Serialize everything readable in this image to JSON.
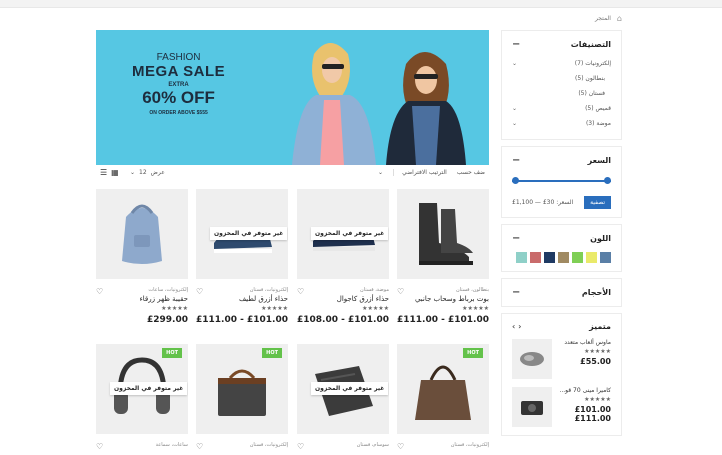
{
  "breadcrumb": {
    "current": "المتجر"
  },
  "sidebar": {
    "categories": {
      "title": "التصنيفات",
      "items": [
        {
          "label": "إلكترونيات (7)",
          "has_children": true,
          "sub": false
        },
        {
          "label": "بنطالون (5)",
          "has_children": false,
          "sub": true
        },
        {
          "label": "فستان (5)",
          "has_children": false,
          "sub": true
        },
        {
          "label": "قميص (5)",
          "has_children": true,
          "sub": false
        },
        {
          "label": "موضة (3)",
          "has_children": true,
          "sub": false
        }
      ]
    },
    "price": {
      "title": "السعر",
      "range_label": "السعر: 30£ — 1,100£",
      "filter_label": "تصفية"
    },
    "color": {
      "title": "اللون",
      "swatches": [
        "#5a7fa6",
        "#eaea6a",
        "#7fcf55",
        "#a08a62",
        "#1f3a63",
        "#c96b6b",
        "#8fd0c8"
      ]
    },
    "sizes": {
      "title": "الأحجام"
    },
    "featured": {
      "title": "متميز",
      "items": [
        {
          "name": "ماوس ألعاب متعدد",
          "price": "£55.00",
          "stars": "★★★★★"
        },
        {
          "name": "كاميرا مينى 70 قو...",
          "price_old": "£101.00",
          "price": "£111.00",
          "stars": "★★★★★"
        }
      ]
    }
  },
  "banner": {
    "line1": "FASHION",
    "line2": "MEGA SALE",
    "line3": "EXTRA",
    "line4": "60% OFF",
    "line5": "ON ORDER ABOVE $555"
  },
  "toolbar": {
    "sort_label": "ضف حسب",
    "sort_value": "الترتيب الافتراضي",
    "show_label": "عرض",
    "show_value": "12"
  },
  "products": [
    {
      "category": "إلكترونيات، ساعات",
      "name": "حقيبة ظهر زرقاء",
      "price": "£299.00",
      "oos": false,
      "hot": false
    },
    {
      "category": "إلكترونيات، فستان",
      "name": "حذاء أزرق لطيف",
      "price": "£111.00 - £101.00",
      "oos": true,
      "hot": false
    },
    {
      "category": "موضة، فستان",
      "name": "حذاء أزرق كاجوال",
      "price": "£108.00 - £101.00",
      "oos": true,
      "hot": false
    },
    {
      "category": "بنطالون، فستان",
      "name": "بوت برباط وسحاب جانبي",
      "price": "£111.00 - £101.00",
      "oos": false,
      "hot": false
    },
    {
      "category": "ساعات، سماعة",
      "name": "",
      "price": "",
      "oos": true,
      "hot": true
    },
    {
      "category": "إلكترونيات، فستان",
      "name": "",
      "price": "",
      "oos": false,
      "hot": true
    },
    {
      "category": "سوسام، فستان",
      "name": "",
      "price": "",
      "oos": true,
      "hot": false
    },
    {
      "category": "إلكترونيات، فستان",
      "name": "",
      "price": "",
      "oos": false,
      "hot": true
    }
  ],
  "labels": {
    "out_of_stock": "غير متوفر في المخزون",
    "hot": "HOT",
    "stars": "★★★★★"
  }
}
